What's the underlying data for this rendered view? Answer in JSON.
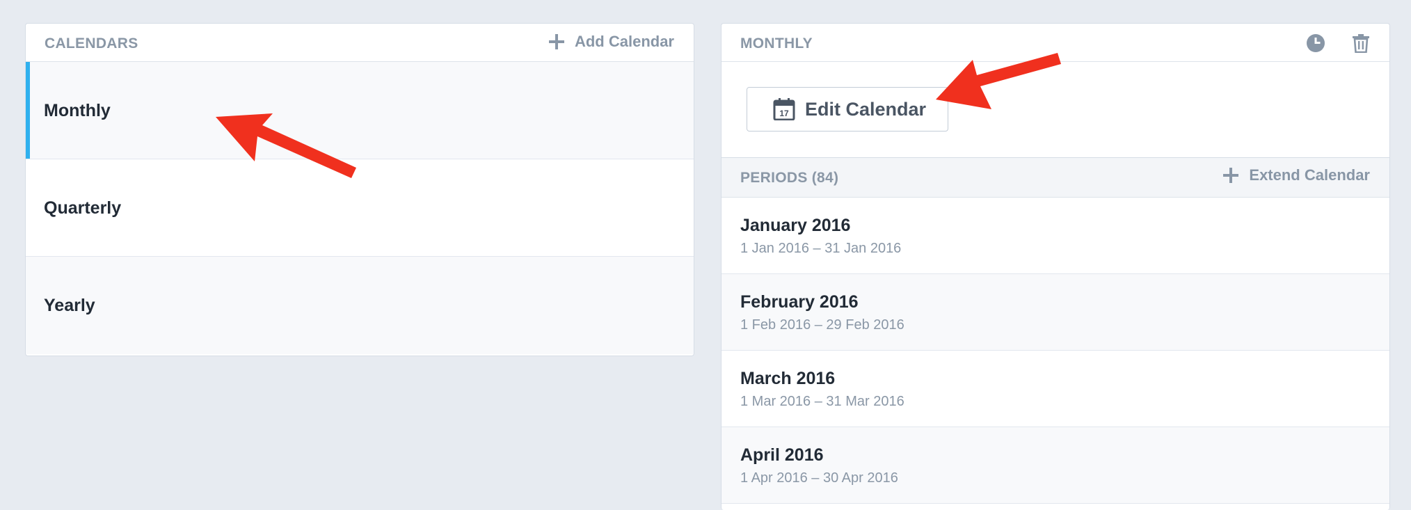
{
  "calendars": {
    "header_title": "CALENDARS",
    "add_label": "Add Calendar",
    "items": [
      {
        "label": "Monthly"
      },
      {
        "label": "Quarterly"
      },
      {
        "label": "Yearly"
      }
    ]
  },
  "detail": {
    "header_title": "MONTHLY",
    "edit_label": "Edit Calendar",
    "edit_icon_day": "17",
    "periods_title": "PERIODS (84)",
    "extend_label": "Extend Calendar",
    "periods": [
      {
        "name": "January 2016",
        "range": "1 Jan 2016 – 31 Jan 2016"
      },
      {
        "name": "February 2016",
        "range": "1 Feb 2016 – 29 Feb 2016"
      },
      {
        "name": "March 2016",
        "range": "1 Mar 2016 – 31 Mar 2016"
      },
      {
        "name": "April 2016",
        "range": "1 Apr 2016 – 30 Apr 2016"
      }
    ]
  },
  "icons": {
    "add": "plus-icon",
    "history": "clock-icon",
    "delete": "trash-icon",
    "calendar": "calendar-icon",
    "annotation": "red-arrow"
  },
  "colors": {
    "background": "#e7ebf1",
    "accent": "#2fb0ee",
    "arrow": "#f0301e",
    "muted_text": "#8a97a6"
  }
}
